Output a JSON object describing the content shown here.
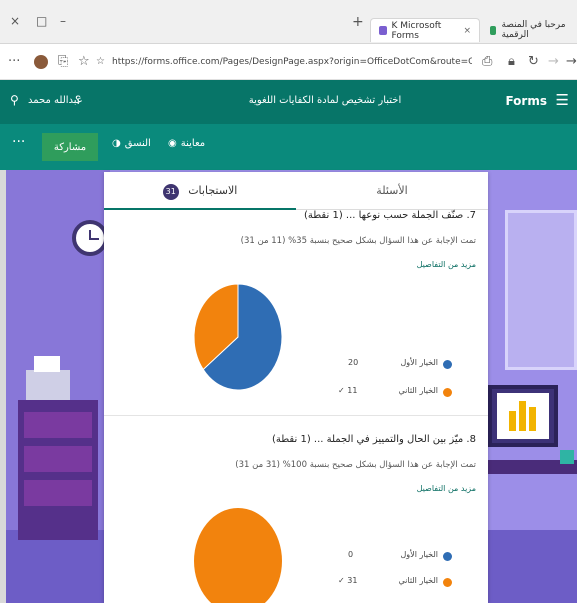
{
  "browser": {
    "window_controls": [
      "×",
      "□",
      "–"
    ],
    "tabs": [
      {
        "label": "K Microsoft Forms",
        "active": true,
        "favicon_color": "#7a5fd0"
      },
      {
        "label": "مرحبا في المنصة الرقمية",
        "active": false,
        "favicon_color": "#2f9d5c"
      }
    ],
    "new_tab": "+",
    "url": "https://forms.office.com/Pages/DesignPage.aspx?origin=OfficeDotCom&route=OfficeHome&lang=ar-SA#Analysis..."
  },
  "forms_header": {
    "brand": "Forms",
    "title": "اختبار تشخيص لمادة الكفايات اللغوية",
    "user": "عبدالله محمد",
    "help": "؟"
  },
  "command_bar": {
    "share_label": "مشاركة",
    "preview_label": "معاينة",
    "theme_label": "النسق",
    "more": "···"
  },
  "results": {
    "tab_questions": "الأسئلة",
    "tab_responses": "الاستجابات",
    "response_count": "31",
    "questions": [
      {
        "title": "7. صنّف الجملة حسب نوعها ... (1 نقطة)",
        "stat": "تمت الإجابة عن هذا السؤال بشكل صحيح بنسبة 35% (11 من 31)",
        "link": "مزيد من التفاصيل",
        "legend": [
          {
            "label": "الخيار الأول",
            "value": "20",
            "color": "#2f6db4",
            "correct": false
          },
          {
            "label": "الخيار الثاني",
            "value": "11",
            "color": "#f2830d",
            "correct": true
          }
        ]
      },
      {
        "title": "8. ميّز بين الحال والتمييز في الجملة ... (1 نقطة)",
        "stat": "تمت الإجابة عن هذا السؤال بشكل صحيح بنسبة 100% (31 من 31)",
        "link": "مزيد من التفاصيل",
        "legend": [
          {
            "label": "الخيار الأول",
            "value": "0",
            "color": "#2f6db4",
            "correct": false
          },
          {
            "label": "الخيار الثاني",
            "value": "31",
            "color": "#f2830d",
            "correct": true
          }
        ]
      }
    ]
  }
}
